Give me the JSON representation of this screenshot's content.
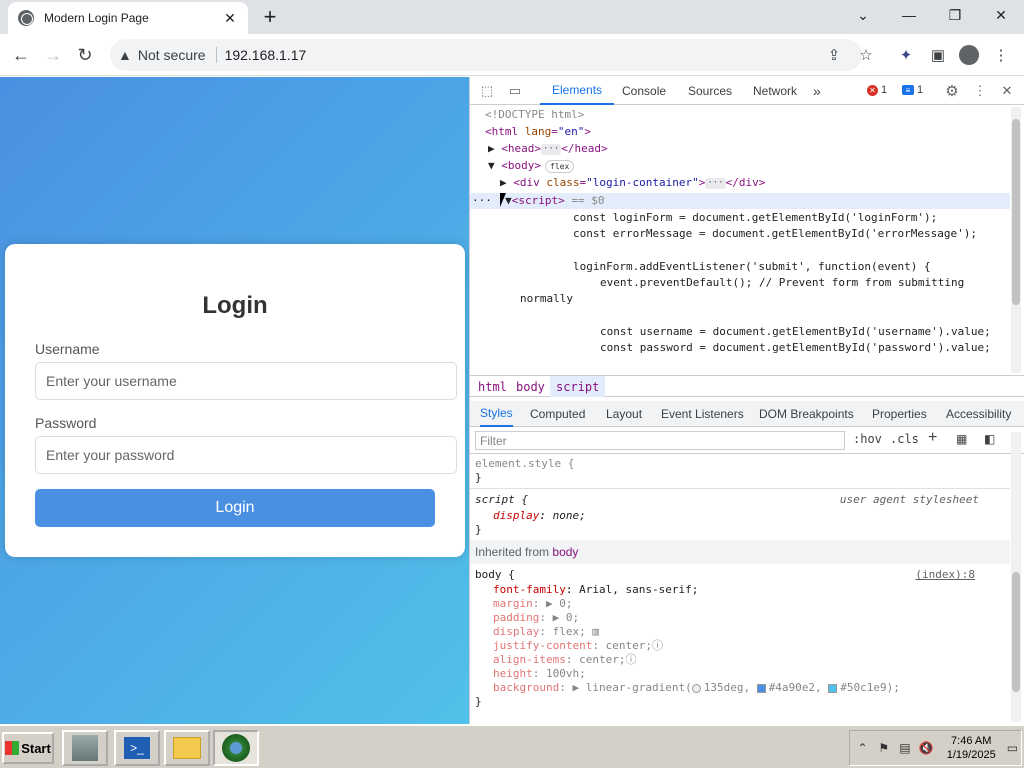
{
  "browser": {
    "tab_title": "Modern Login Page",
    "tab_close": "✕",
    "new_tab": "+",
    "win_min": "—",
    "win_max": "❐",
    "win_close": "✕",
    "security_label": "Not secure",
    "url": "192.168.1.17"
  },
  "page": {
    "heading": "Login",
    "username_label": "Username",
    "username_placeholder": "Enter your username",
    "password_label": "Password",
    "password_placeholder": "Enter your password",
    "button_label": "Login",
    "gradient_start": "#4a90e2",
    "gradient_end": "#50c1e9"
  },
  "devtools": {
    "tabs": [
      "Elements",
      "Console",
      "Sources",
      "Network"
    ],
    "more_tabs": "»",
    "error_count": "1",
    "message_count": "1",
    "dom": {
      "doctype": "<!DOCTYPE html>",
      "html_open": "<html ",
      "html_attr": "lang",
      "html_val": "\"en\"",
      "head": "<head>",
      "head_close": "</head>",
      "body": "<body>",
      "body_badge": "flex",
      "div_open": "<div ",
      "div_attr": "class",
      "div_val": "\"login-container\"",
      "div_close": "</div>",
      "script": "<script>",
      "script_eq": " == $0",
      "code1": "const loginForm = document.getElementById('loginForm');",
      "code2": "const errorMessage = document.getElementById('errorMessage');",
      "code3": "loginForm.addEventListener('submit', function(event) {",
      "code4": "event.preventDefault(); // Prevent form from submitting",
      "code5": "normally",
      "code6": "const username = document.getElementById('username').value;",
      "code7": "const password = document.getElementById('password').value;"
    },
    "breadcrumbs": [
      "html",
      "body",
      "script"
    ],
    "subtabs": [
      "Styles",
      "Computed",
      "Layout",
      "Event Listeners",
      "DOM Breakpoints",
      "Properties",
      "Accessibility"
    ],
    "filter_placeholder": "Filter",
    "hov": ":hov",
    "cls": ".cls",
    "styles": {
      "element_style": "element.style {",
      "close_brace": "}",
      "script_rule": "script {",
      "ua_label": "user agent stylesheet",
      "script_prop": "display",
      "script_val": "none;",
      "inherited_label": "Inherited from",
      "inherited_from": "body",
      "body_rule": "body {",
      "body_source": "(index):8",
      "p1": "font-family",
      "v1": "Arial, sans-serif;",
      "p2": "margin",
      "v2": "0;",
      "p3": "padding",
      "v3": "0;",
      "p4": "display",
      "v4": "flex;",
      "p5": "justify-content",
      "v5": "center;",
      "p6": "align-items",
      "v6": "center;",
      "p7": "height",
      "v7": "100vh;",
      "p8": "background",
      "v8a": "linear-gradient(",
      "v8b": "135deg,",
      "v8c": "#4a90e2,",
      "v8d": "#50c1e9);"
    }
  },
  "taskbar": {
    "start_label": "Start",
    "time": "7:46 AM",
    "date": "1/19/2025"
  }
}
